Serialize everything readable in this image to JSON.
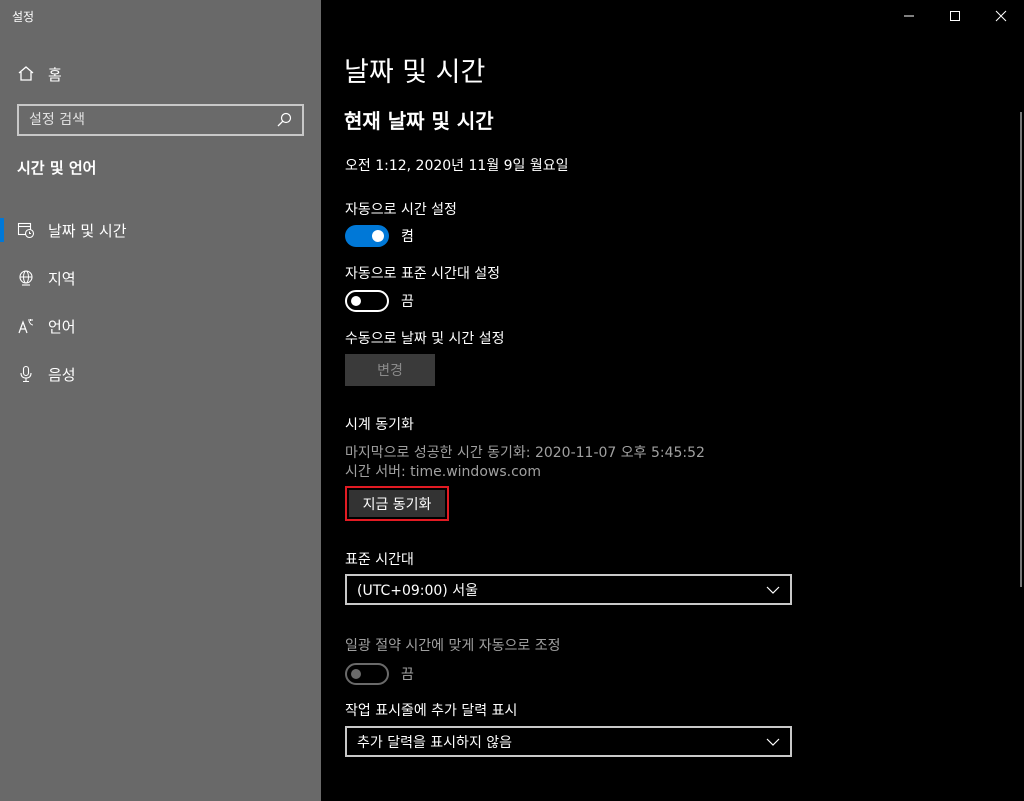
{
  "window": {
    "title": "설정"
  },
  "sidebar": {
    "home_label": "홈",
    "search_placeholder": "설정 검색",
    "section_title": "시간 및 언어",
    "items": [
      {
        "label": "날짜 및 시간",
        "icon": "calendar-clock-icon",
        "active": true
      },
      {
        "label": "지역",
        "icon": "globe-icon",
        "active": false
      },
      {
        "label": "언어",
        "icon": "language-icon",
        "active": false
      },
      {
        "label": "음성",
        "icon": "microphone-icon",
        "active": false
      }
    ]
  },
  "main": {
    "page_title": "날짜 및 시간",
    "sub_title": "현재 날짜 및 시간",
    "current_datetime": "오전 1:12, 2020년 11월 9일 월요일",
    "auto_time": {
      "label": "자동으로 시간 설정",
      "state_text": "켬",
      "on": true
    },
    "auto_timezone": {
      "label": "자동으로 표준 시간대 설정",
      "state_text": "끔",
      "on": false
    },
    "manual_set": {
      "label": "수동으로 날짜 및 시간 설정",
      "button_label": "변경"
    },
    "sync": {
      "heading": "시계 동기화",
      "last_sync": "마지막으로 성공한 시간 동기화: 2020-11-07 오후 5:45:52",
      "server": "시간 서버: time.windows.com",
      "button_label": "지금 동기화"
    },
    "timezone": {
      "label": "표준 시간대",
      "selected": "(UTC+09:00) 서울"
    },
    "dst": {
      "label": "일광 절약 시간에 맞게 자동으로 조정",
      "state_text": "끔",
      "on": false,
      "disabled": true
    },
    "calendar": {
      "label": "작업 표시줄에 추가 달력 표시",
      "selected": "추가 달력을 표시하지 않음"
    }
  },
  "colors": {
    "accent": "#0078d7",
    "highlight_border": "#e21b23",
    "sidebar_bg": "#696969",
    "main_bg": "#000000"
  }
}
